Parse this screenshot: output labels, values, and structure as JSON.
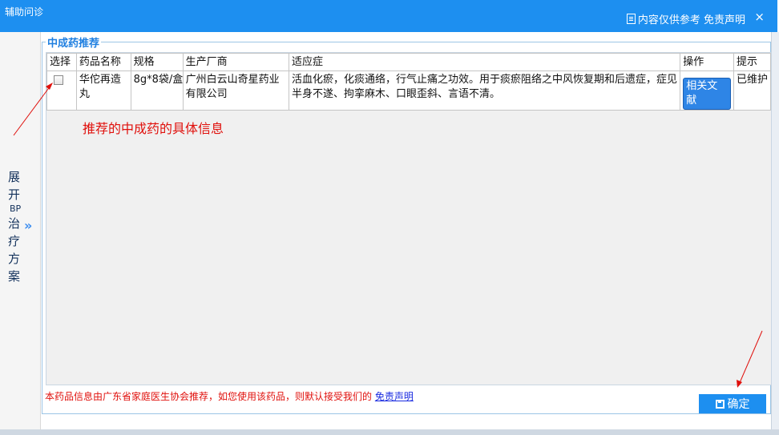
{
  "window": {
    "title": "辅助问诊",
    "notice": "内容仅供参考 免责声明",
    "close_glyph": "×"
  },
  "sidebar": {
    "expand_chars_top": [
      "展",
      "开"
    ],
    "bp": "BP",
    "expand_chars_bottom": [
      "治",
      "疗",
      "方",
      "案"
    ],
    "arrow": "»"
  },
  "group": {
    "legend": "中成药推荐"
  },
  "table": {
    "headers": [
      "选择",
      "药品名称",
      "规格",
      "生产厂商",
      "适应症",
      "操作",
      "提示"
    ],
    "rows": [
      {
        "name": "华佗再造丸",
        "spec": "8g*8袋/盒",
        "manufacturer": "广州白云山奇星药业有限公司",
        "indication": "活血化瘀，化痰通络，行气止痛之功效。用于痰瘀阻络之中风恢复期和后遗症，症见半身不遂、拘挛麻木、口眼歪斜、言语不清。",
        "action": "相关文献",
        "tip": "已维护"
      }
    ]
  },
  "annotation": "推荐的中成药的具体信息",
  "footer": {
    "disclaimer": "本药品信息由广东省家庭医生协会推荐，如您使用该药品，则默认接受我们的 ",
    "link": "免责声明"
  },
  "ok_button": "确定",
  "colors": {
    "titlebar": "#1d8ff0",
    "annotation": "#e0100c",
    "legend": "#1f7fe0"
  }
}
